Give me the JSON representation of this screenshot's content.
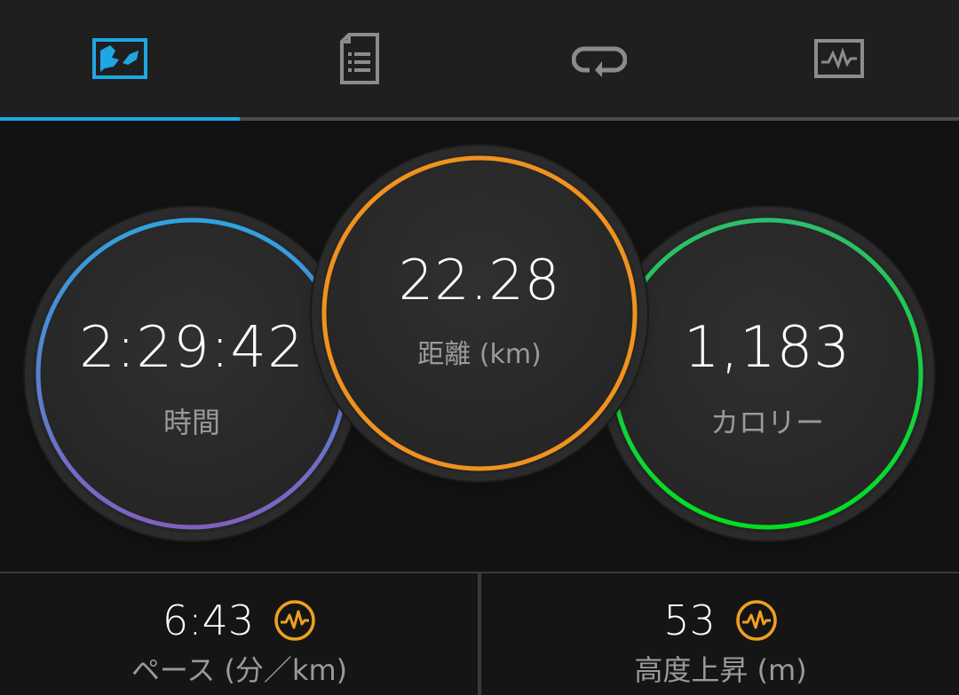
{
  "tabs": [
    {
      "id": "summary",
      "icon": "summary-chart-icon",
      "active": true
    },
    {
      "id": "details",
      "icon": "document-list-icon",
      "active": false
    },
    {
      "id": "laps",
      "icon": "loop-arrow-icon",
      "active": false
    },
    {
      "id": "graphs",
      "icon": "activity-graph-icon",
      "active": false
    }
  ],
  "colors": {
    "accent": "#1fa7e4",
    "time_ring_start": "#2fa3e0",
    "time_ring_end": "#8060c0",
    "distance_ring": "#f0921e",
    "calories_ring_start": "#2dbf6a",
    "calories_ring_end": "#00e020",
    "pulse_icon": "#f0a020"
  },
  "metrics": {
    "time": {
      "value": "2:29:42",
      "label": "時間"
    },
    "distance": {
      "value": "22.28",
      "label": "距離 (km)"
    },
    "calories": {
      "value": "1,183",
      "label": "カロリー"
    }
  },
  "stats": {
    "pace": {
      "value": "6:43",
      "label": "ペース (分／km)",
      "icon": "pulse-icon"
    },
    "elevation": {
      "value": "53",
      "label": "高度上昇 (m)",
      "icon": "pulse-icon"
    }
  }
}
